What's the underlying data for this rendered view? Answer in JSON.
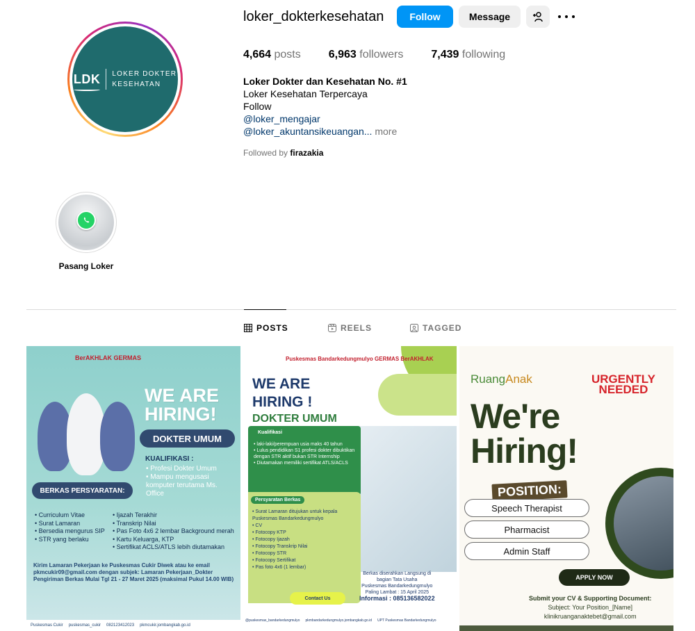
{
  "profile": {
    "username": "loker_dokterkesehatan",
    "avatar": {
      "logo_mark": "LDK",
      "logo_line1": "LOKER DOKTER",
      "logo_line2": "KESEHATAN"
    },
    "buttons": {
      "follow": "Follow",
      "message": "Message",
      "add_user_icon": "add-person-icon",
      "more_icon": "more-options-icon"
    },
    "stats": {
      "posts_count": "4,664",
      "posts_label": "posts",
      "followers_count": "6,963",
      "followers_label": "followers",
      "following_count": "7,439",
      "following_label": "following"
    },
    "bio": {
      "name": "Loker Dokter dan Kesehatan No. #1",
      "line1": "Loker Kesehatan Terpercaya",
      "line2": "Follow",
      "link1": "@loker_mengajar",
      "link2": "@loker_akuntansikeuangan...",
      "more": "more"
    },
    "followed_by_prefix": "Followed by",
    "followed_by_user": "firazakia"
  },
  "highlight": {
    "label": "Pasang Loker",
    "icon": "whatsapp-icon"
  },
  "tabs": [
    {
      "label": "POSTS",
      "icon": "grid-icon",
      "active": true
    },
    {
      "label": "REELS",
      "icon": "reels-icon",
      "active": false
    },
    {
      "label": "TAGGED",
      "icon": "tagged-icon",
      "active": false
    }
  ],
  "posts": {
    "post1": {
      "logos": "BerAKHLAK   GERMAS",
      "headline1": "WE ARE",
      "headline2": "HIRING!",
      "role": "DOKTER UMUM",
      "kualifikasi_title": "KUALIFIKASI :",
      "kualifikasi": "• Profesi Dokter Umum\n• Mampu mengusasi komputer terutama Ms. Office",
      "berkas_title": "BERKAS PERSYARATAN:",
      "col1": [
        "• Curriculum Vitae",
        "• Surat Lamaran",
        "• Bersedia mengurus SIP",
        "• STR yang berlaku"
      ],
      "col2": [
        "• Ijazah Terakhir",
        "• Transkrip Nilai",
        "• Pas Foto 4x6 2 lembar Background merah",
        "• Kartu Keluarga, KTP",
        "• Sertifikat ACLS/ATLS lebih diutamakan"
      ],
      "footer1": "Kirim Lamaran Pekerjaan ke Puskesmas Cukir Diwek atau ke email",
      "footer2": "pkmcukir09@gmail.com dengan subjek: Lamaran  Pekerjaan_Dokter",
      "footer3": "Pengiriman Berkas Mulai Tgl 21 - 27 Maret 2025 (maksimal Pukul 14.00 WIB)",
      "bottom": [
        "Puskesmas Cukir",
        "puskesmas_cukir",
        "082123412023",
        "pkmcukir.jombangkab.go.id"
      ]
    },
    "post2": {
      "logos": "Puskesmas Bandarkedungmulyo   GERMAS   BerAKHLAK",
      "headline1": "WE ARE",
      "headline2": "HIRING !",
      "role": "DOKTER UMUM",
      "kual_title": "Kualifikasi",
      "kual_list": "• laki-laki/perempuan usia maks 40 tahun\n• Lulus pendidikan S1 profesi dokter dibuktikan dengan STR aktif bukan STR Internship\n• Diutamakan memiliki sertifikat ATLS/ACLS",
      "berkas_title": "Persyaratan Berkas",
      "berkas_list": "• Surat Lamaran ditujukan untuk kepala Puskesmas Bandarkedungmulyo\n• CV\n• Fotocopy KTP\n• Fotocopy Ijazah\n• Fotocopy Transkrip Nilai\n• Fotocopy STR\n• Fotocopy Sertifikat\n• Pas foto 4x6 (1 lembar)",
      "info1": "Berkas diserahkan Langsung di",
      "info2": "bagian Tata Usaha",
      "info3": "Puskesmas Bandarkedungmulyo",
      "info4": "Paling Lambat : 15 April 2025",
      "info5": "Informasi : 085136582022",
      "contact": "Contact Us",
      "bottom": [
        "@puskesmas_bandarkedungmulyo",
        "pkmbandarkedungmulyo.jombangkab.go.id",
        "UPT Puskesmas Bandarkedungmulyo"
      ]
    },
    "post3": {
      "brand_a": "Ruang",
      "brand_b": "Anak",
      "urgent1": "URGENTLY",
      "urgent2": "NEEDED",
      "headline1": "We're",
      "headline2": "Hiring!",
      "position": "POSITION:",
      "roles": [
        "Speech Therapist",
        "Pharmacist",
        "Admin Staff"
      ],
      "apply": "APPLY NOW",
      "submit1": "Submit your CV & Supporting Document:",
      "submit2": "Subject: Your Position_[Name]",
      "submit3": "klinikruanganaktebet@gmail.com"
    }
  },
  "colors": {
    "follow": "#0095f6",
    "link": "#00376b",
    "muted": "#737373",
    "border": "#dbdbdb"
  }
}
